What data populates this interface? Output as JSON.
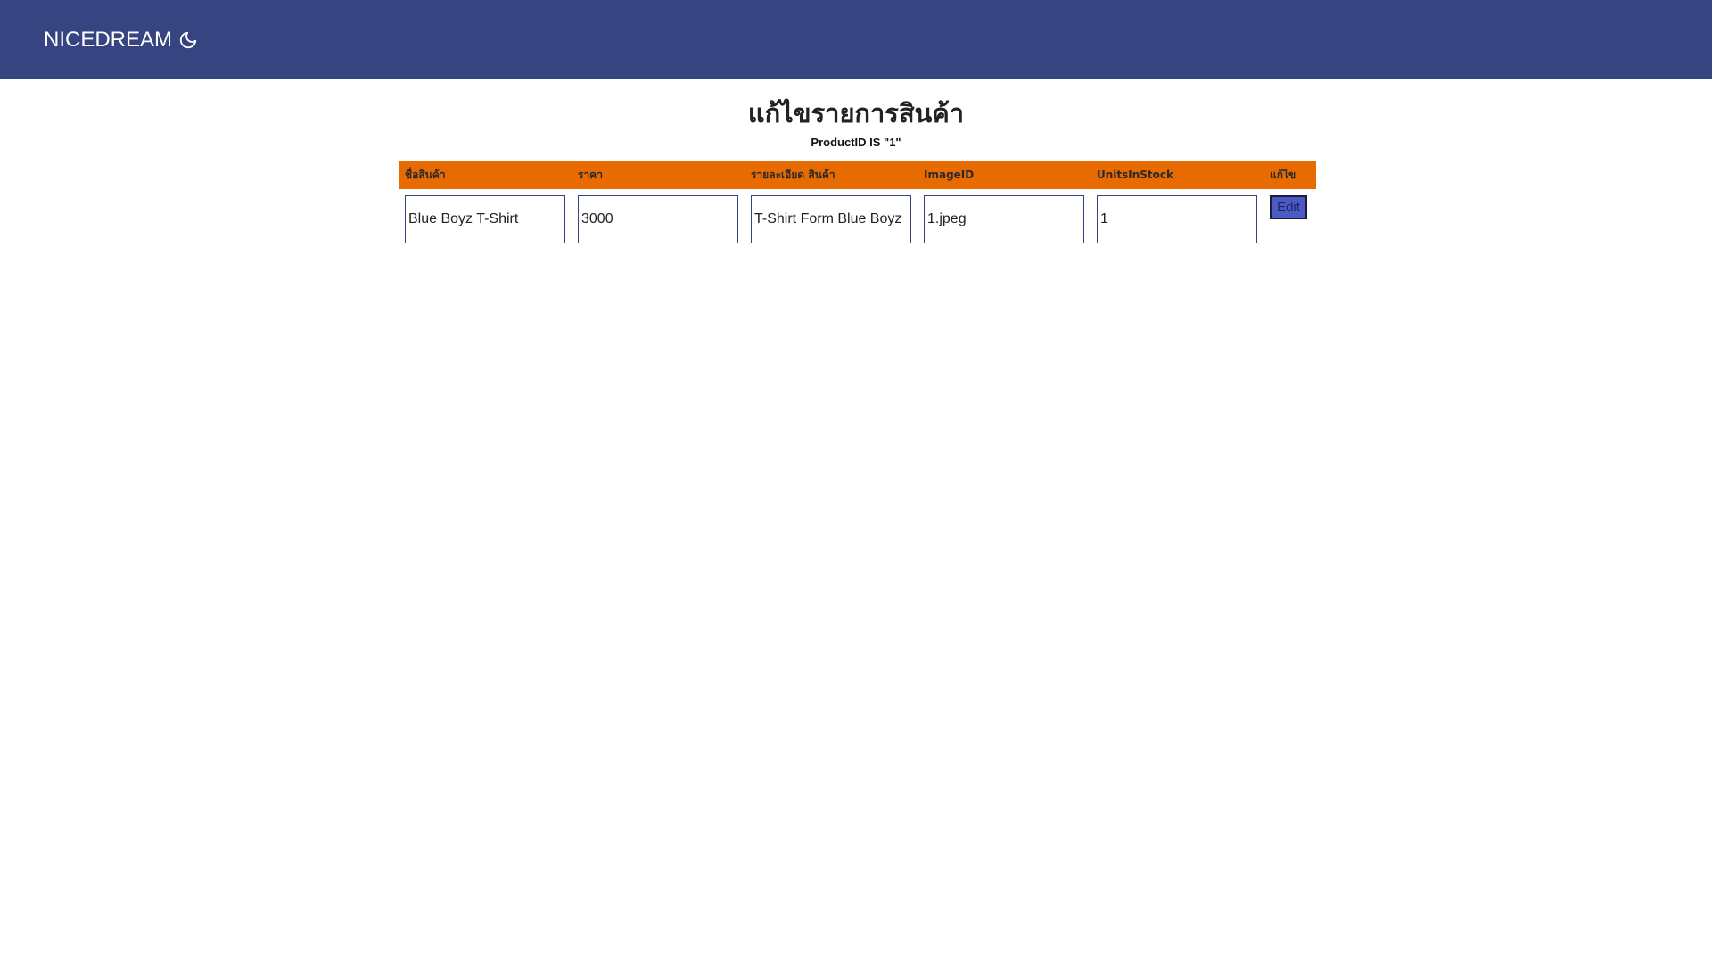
{
  "navbar": {
    "brand": "NICEDREAM",
    "brand_icon": "moon-icon",
    "background": "#364481"
  },
  "page": {
    "title": "แก้ไขรายการสินค้า",
    "subtitle": "ProductID IS \"1\""
  },
  "table": {
    "header_color": "#e76b01",
    "headers": [
      "ชื่อสินค้า",
      "ราคา",
      "รายละเอียด สินค้า",
      "ImageID",
      "UnitsInStock",
      "แก้ไข"
    ],
    "row": {
      "name": "Blue Boyz T-Shirt",
      "price": "3000",
      "description": "T-Shirt Form Blue Boyz",
      "image_id": "1.jpeg",
      "units_in_stock": "1",
      "edit_label": "Edit"
    }
  }
}
